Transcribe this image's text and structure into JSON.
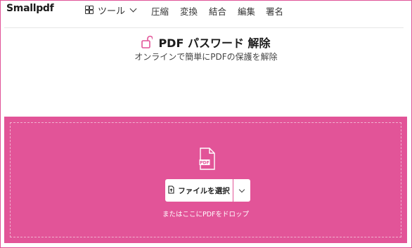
{
  "header": {
    "logo": "Smallpdf",
    "tools_label": "ツール",
    "nav": [
      "圧縮",
      "変換",
      "結合",
      "編集",
      "署名"
    ]
  },
  "main": {
    "title": "PDF パスワード 解除",
    "subtitle": "オンラインで簡単にPDFの保護を解除"
  },
  "dropzone": {
    "select_label": "ファイルを選択",
    "hint": "またはここにPDFをドロップ",
    "file_icon_text": "PDF"
  },
  "colors": {
    "accent": "#e25498",
    "frame": "#e05297"
  },
  "icons": [
    "grid-icon",
    "chevron-down-icon",
    "unlock-icon",
    "pdf-file-icon",
    "file-upload-icon"
  ]
}
